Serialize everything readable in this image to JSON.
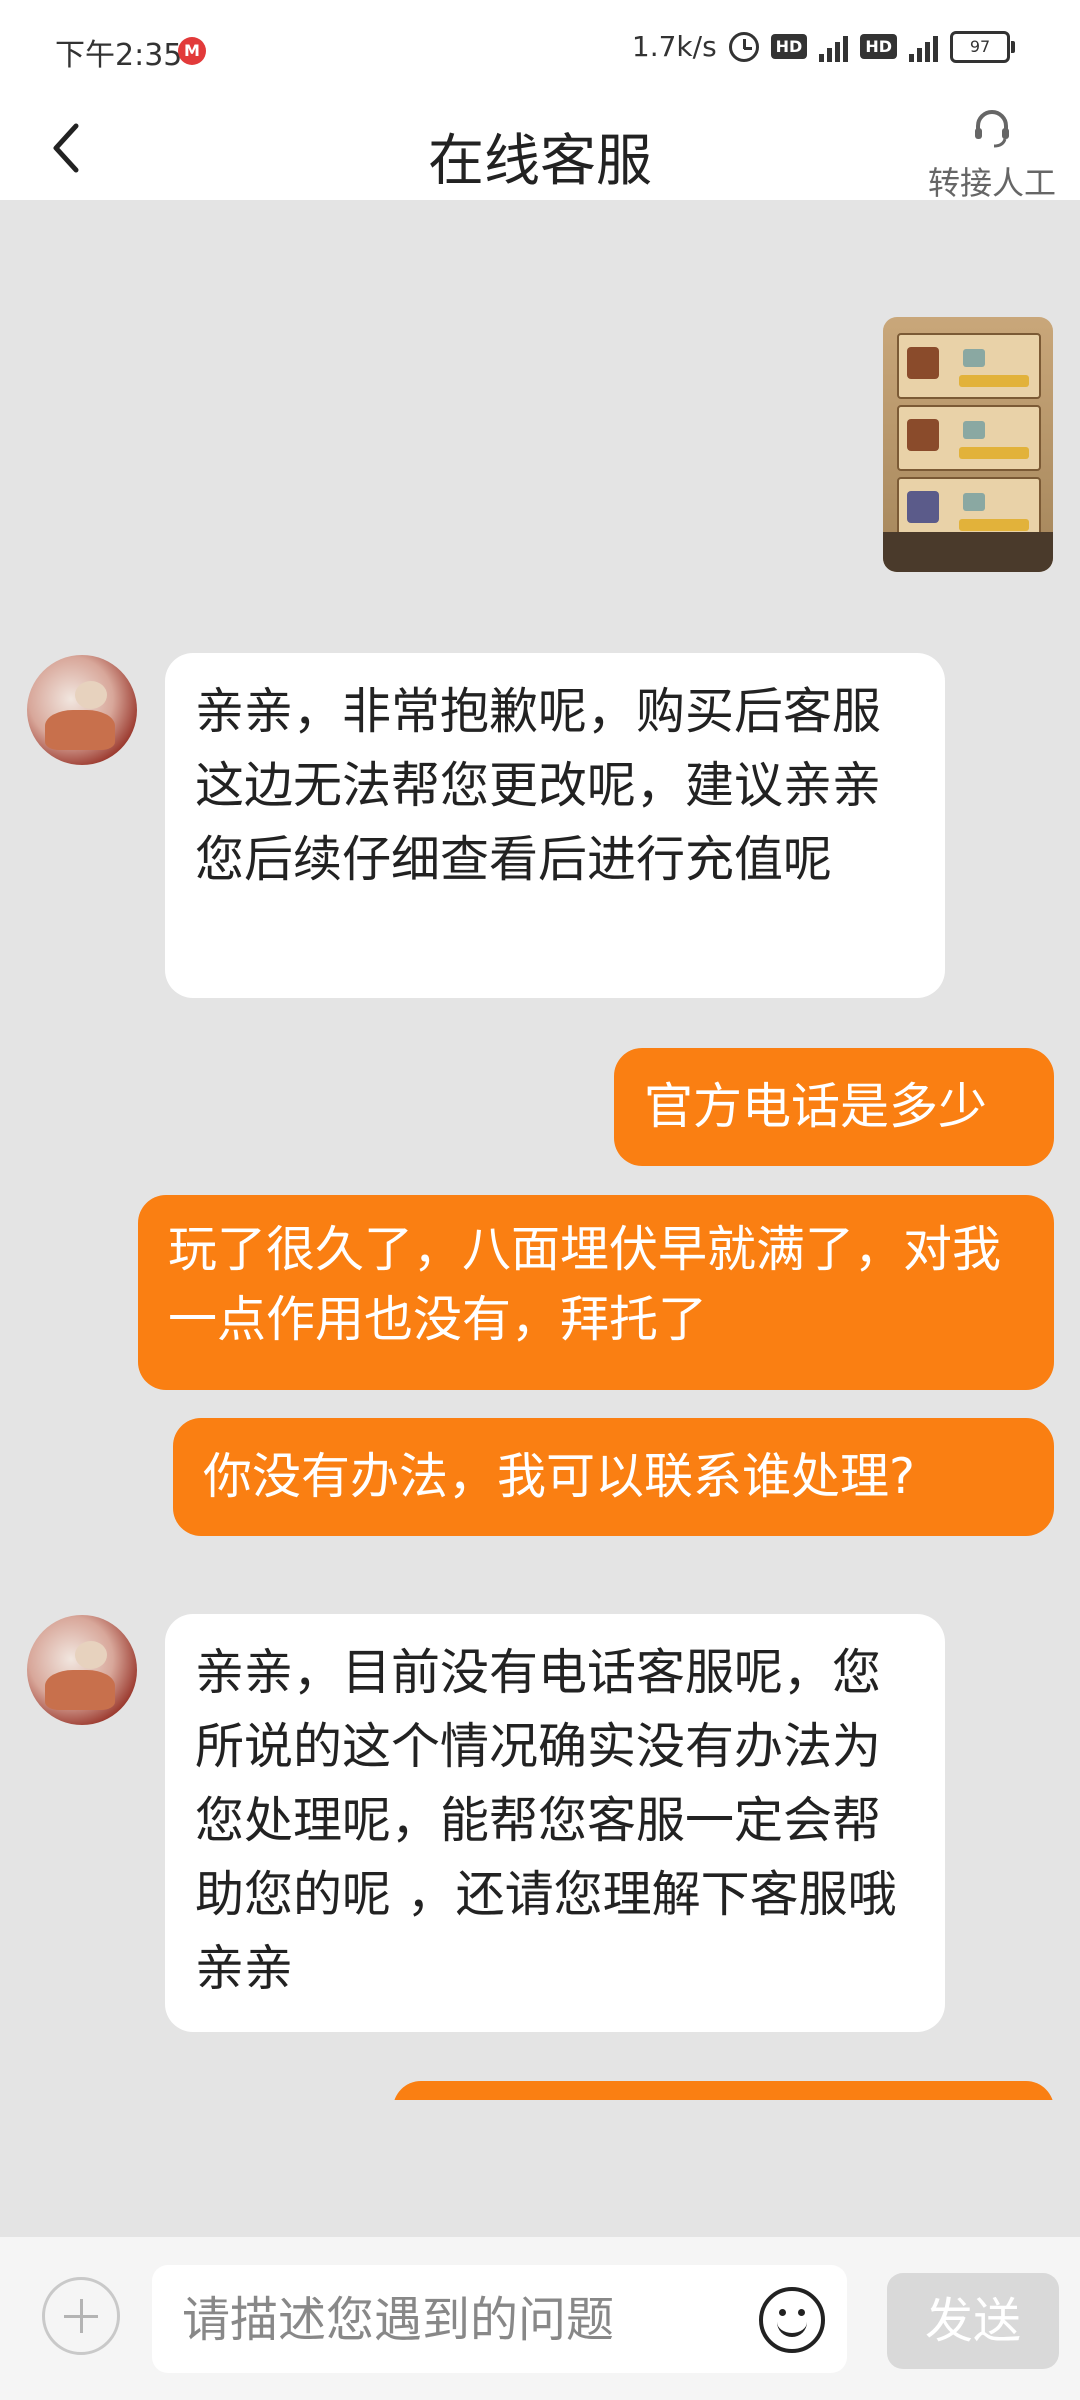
{
  "status_bar": {
    "time": "下午2:35",
    "net_speed": "1.7k/s",
    "hd1": "HD",
    "hd2": "HD",
    "battery": "97"
  },
  "header": {
    "title": "在线客服",
    "transfer_label": "转接人工"
  },
  "messages": [
    {
      "from": "user",
      "type": "image"
    },
    {
      "from": "agent",
      "text": "亲亲，非常抱歉呢，购买后客服这边无法帮您更改呢，建议亲亲您后续仔细查看后进行充值呢"
    },
    {
      "from": "user",
      "text": "官方电话是多少"
    },
    {
      "from": "user",
      "text": "玩了很久了，八面埋伏早就满了，对我一点作用也没有，拜托了"
    },
    {
      "from": "user",
      "text": "你没有办法，我可以联系谁处理?"
    },
    {
      "from": "agent",
      "text": "亲亲，目前没有电话客服呢，您所说的这个情况确实没有办法为您处理呢，能帮您客服一定会帮助您的呢 ，还请您理解下客服哦亲亲"
    }
  ],
  "input_bar": {
    "placeholder": "请描述您遇到的问题",
    "send_label": "发送"
  },
  "colors": {
    "accent": "#fa7f12",
    "chat_bg": "#e4e4e4"
  }
}
